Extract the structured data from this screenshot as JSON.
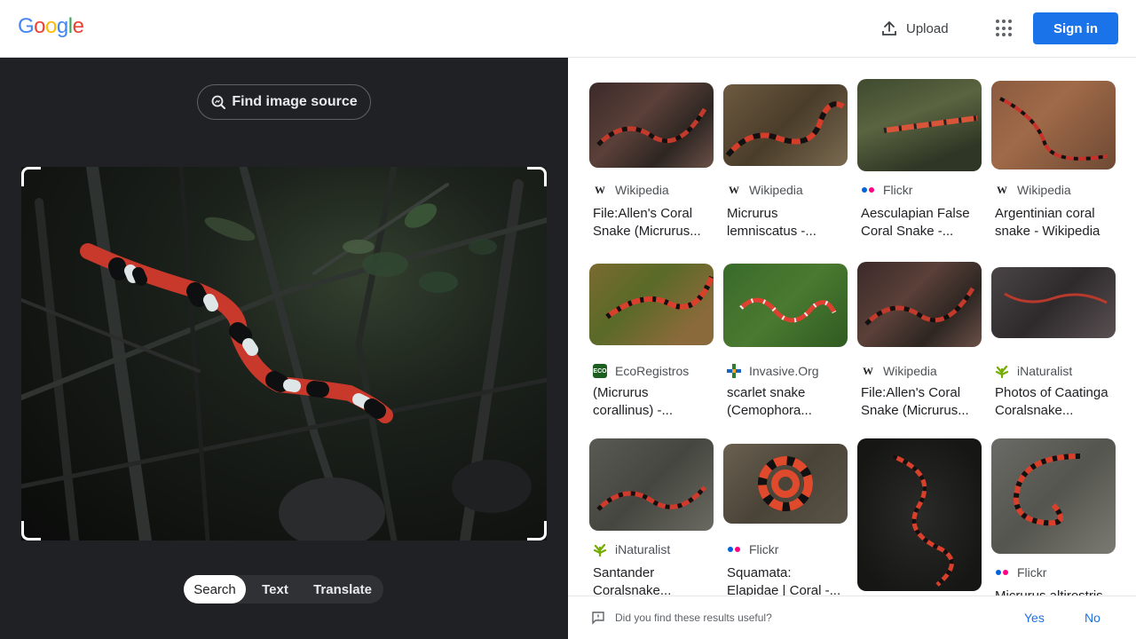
{
  "header": {
    "logo_letters": [
      {
        "char": "G",
        "color": "#4285f4"
      },
      {
        "char": "o",
        "color": "#ea4335"
      },
      {
        "char": "o",
        "color": "#fbbc05"
      },
      {
        "char": "g",
        "color": "#4285f4"
      },
      {
        "char": "l",
        "color": "#34a853"
      },
      {
        "char": "e",
        "color": "#ea4335"
      }
    ],
    "upload_label": "Upload",
    "upload_icon": "upload-icon",
    "apps_icon": "apps-grid-icon",
    "signin_label": "Sign in",
    "accent": "#1a73e8"
  },
  "left": {
    "find_source_label": "Find image source",
    "find_source_icon": "image-search-icon",
    "modes": {
      "search": "Search",
      "text": "Text",
      "translate": "Translate",
      "active": "Search"
    }
  },
  "results": [
    {
      "source": "Wikipedia",
      "favicon": "W",
      "title": "File:Allen's Coral Snake (Micrurus..."
    },
    {
      "source": "Wikipedia",
      "favicon": "W",
      "title": "Micrurus lemniscatus -..."
    },
    {
      "source": "Flickr",
      "favicon": "flickr-dots",
      "title": "Aesculapian False Coral Snake -..."
    },
    {
      "source": "Wikipedia",
      "favicon": "W",
      "title": "Argentinian coral snake - Wikipedia"
    },
    {
      "source": "EcoRegistros",
      "favicon": "eco",
      "title": "(Micrurus corallinus) -..."
    },
    {
      "source": "Invasive.Org",
      "favicon": "invasive",
      "title": "scarlet snake (Cemophora..."
    },
    {
      "source": "Wikipedia",
      "favicon": "W",
      "title": "File:Allen's Coral Snake (Micrurus..."
    },
    {
      "source": "iNaturalist",
      "favicon": "inat",
      "title": "Photos of Caatinga Coralsnake..."
    },
    {
      "source": "iNaturalist",
      "favicon": "inat",
      "title": "Santander Coralsnake..."
    },
    {
      "source": "Flickr",
      "favicon": "flickr-dots",
      "title": "Squamata: Elapidae | Coral -..."
    },
    {
      "source": "",
      "favicon": "",
      "title": ""
    },
    {
      "source": "Flickr",
      "favicon": "flickr-dots",
      "title": "Micrurus altirostris"
    }
  ],
  "feedback": {
    "question": "Did you find these results useful?",
    "yes": "Yes",
    "no": "No"
  }
}
